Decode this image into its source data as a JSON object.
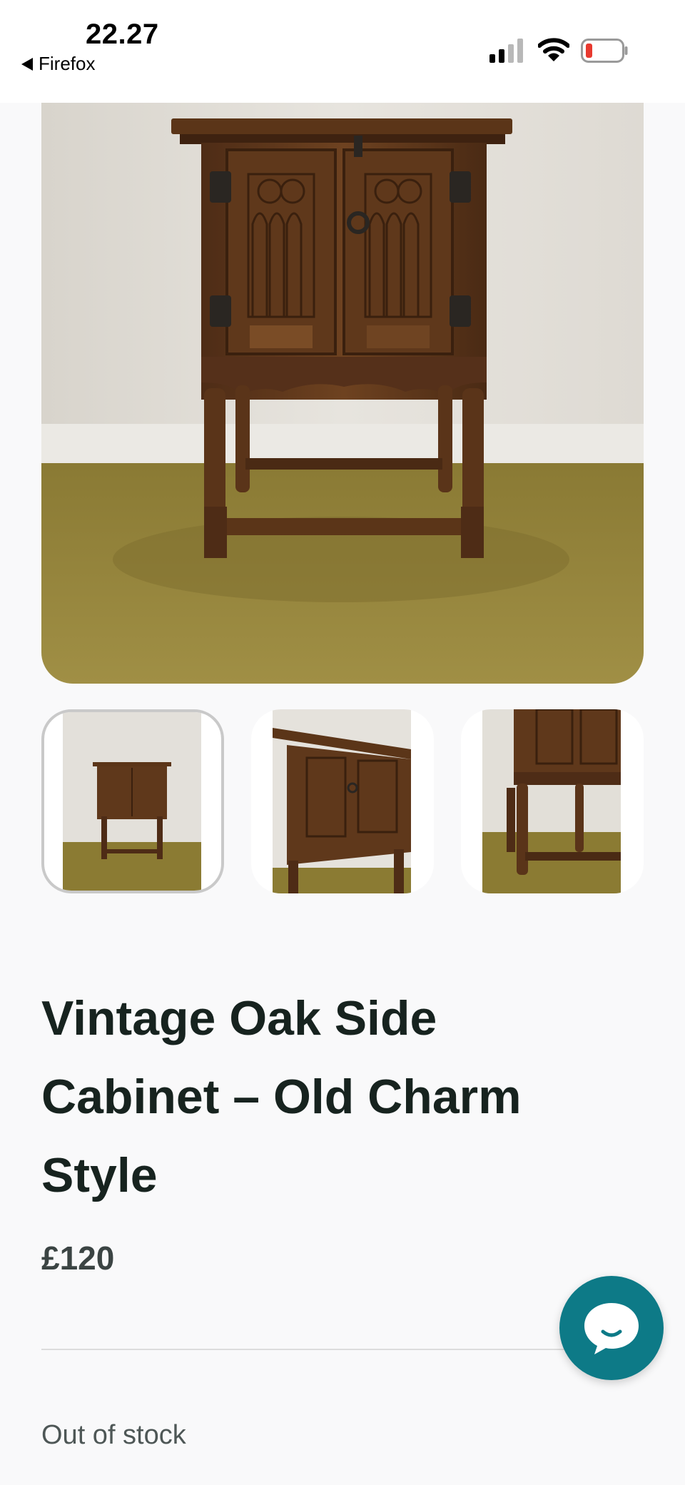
{
  "status_bar": {
    "time": "22.27",
    "back_app": "Firefox"
  },
  "icons": {
    "back": "back-arrow-icon",
    "signal": "cellular-signal-icon",
    "wifi": "wifi-icon",
    "battery": "battery-low-icon",
    "chat": "chat-bubble-icon"
  },
  "gallery": {
    "thumbnails": [
      {
        "view": "front-full",
        "selected": true
      },
      {
        "view": "angled-closeup",
        "selected": false
      },
      {
        "view": "side-corner-closeup",
        "selected": false
      }
    ]
  },
  "product": {
    "title": "Vintage Oak Side Cabinet – Old Charm Style",
    "price": "£120",
    "stock_status": "Out of stock"
  },
  "colors": {
    "accent": "#0d7a87",
    "title_text": "#17231f",
    "battery_low": "#e8392f"
  }
}
